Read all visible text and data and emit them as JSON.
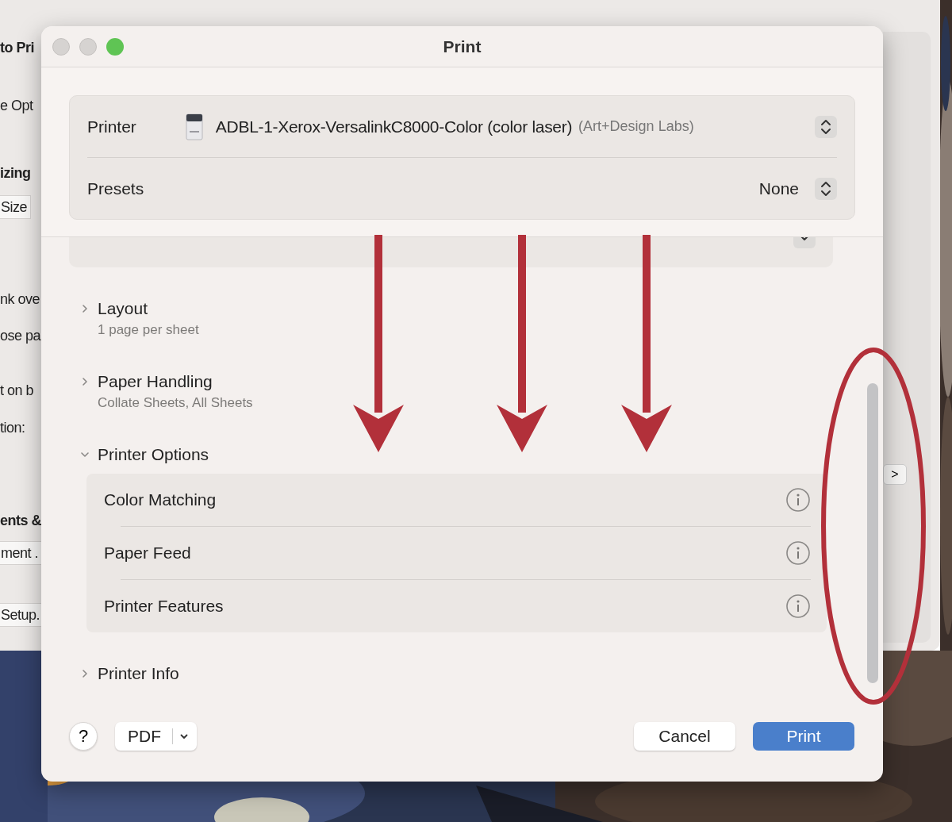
{
  "background_window": {
    "items": [
      {
        "text": "to Pri",
        "kind": "heading"
      },
      {
        "text": "e Opt",
        "kind": "plain"
      },
      {
        "text": "izing",
        "kind": "heading"
      },
      {
        "text": "Size",
        "kind": "field"
      },
      {
        "text": "nk ove",
        "kind": "plain"
      },
      {
        "text": "ose pa",
        "kind": "plain"
      },
      {
        "text": "t on b",
        "kind": "plain"
      },
      {
        "text": "tion:",
        "kind": "plain"
      },
      {
        "text": "ents &",
        "kind": "heading"
      },
      {
        "text": "ment .",
        "kind": "field"
      },
      {
        "text": "Setup.",
        "kind": "field"
      }
    ],
    "next_button": ">"
  },
  "dialog": {
    "title": "Print",
    "printer": {
      "label": "Printer",
      "name": "ADBL-1-Xerox-VersalinkC8000-Color (color laser)",
      "location": "(Art+Design Labs)"
    },
    "presets": {
      "label": "Presets",
      "value": "None"
    },
    "sections": [
      {
        "title": "Layout",
        "summary": "1 page per sheet",
        "expanded": false
      },
      {
        "title": "Paper Handling",
        "summary": "Collate Sheets, All Sheets",
        "expanded": false
      },
      {
        "title": "Printer Options",
        "expanded": true,
        "items": [
          "Color Matching",
          "Paper Feed",
          "Printer Features"
        ]
      },
      {
        "title": "Printer Info",
        "expanded": false
      }
    ],
    "footer": {
      "help": "?",
      "pdf": "PDF",
      "cancel": "Cancel",
      "print": "Print"
    }
  }
}
